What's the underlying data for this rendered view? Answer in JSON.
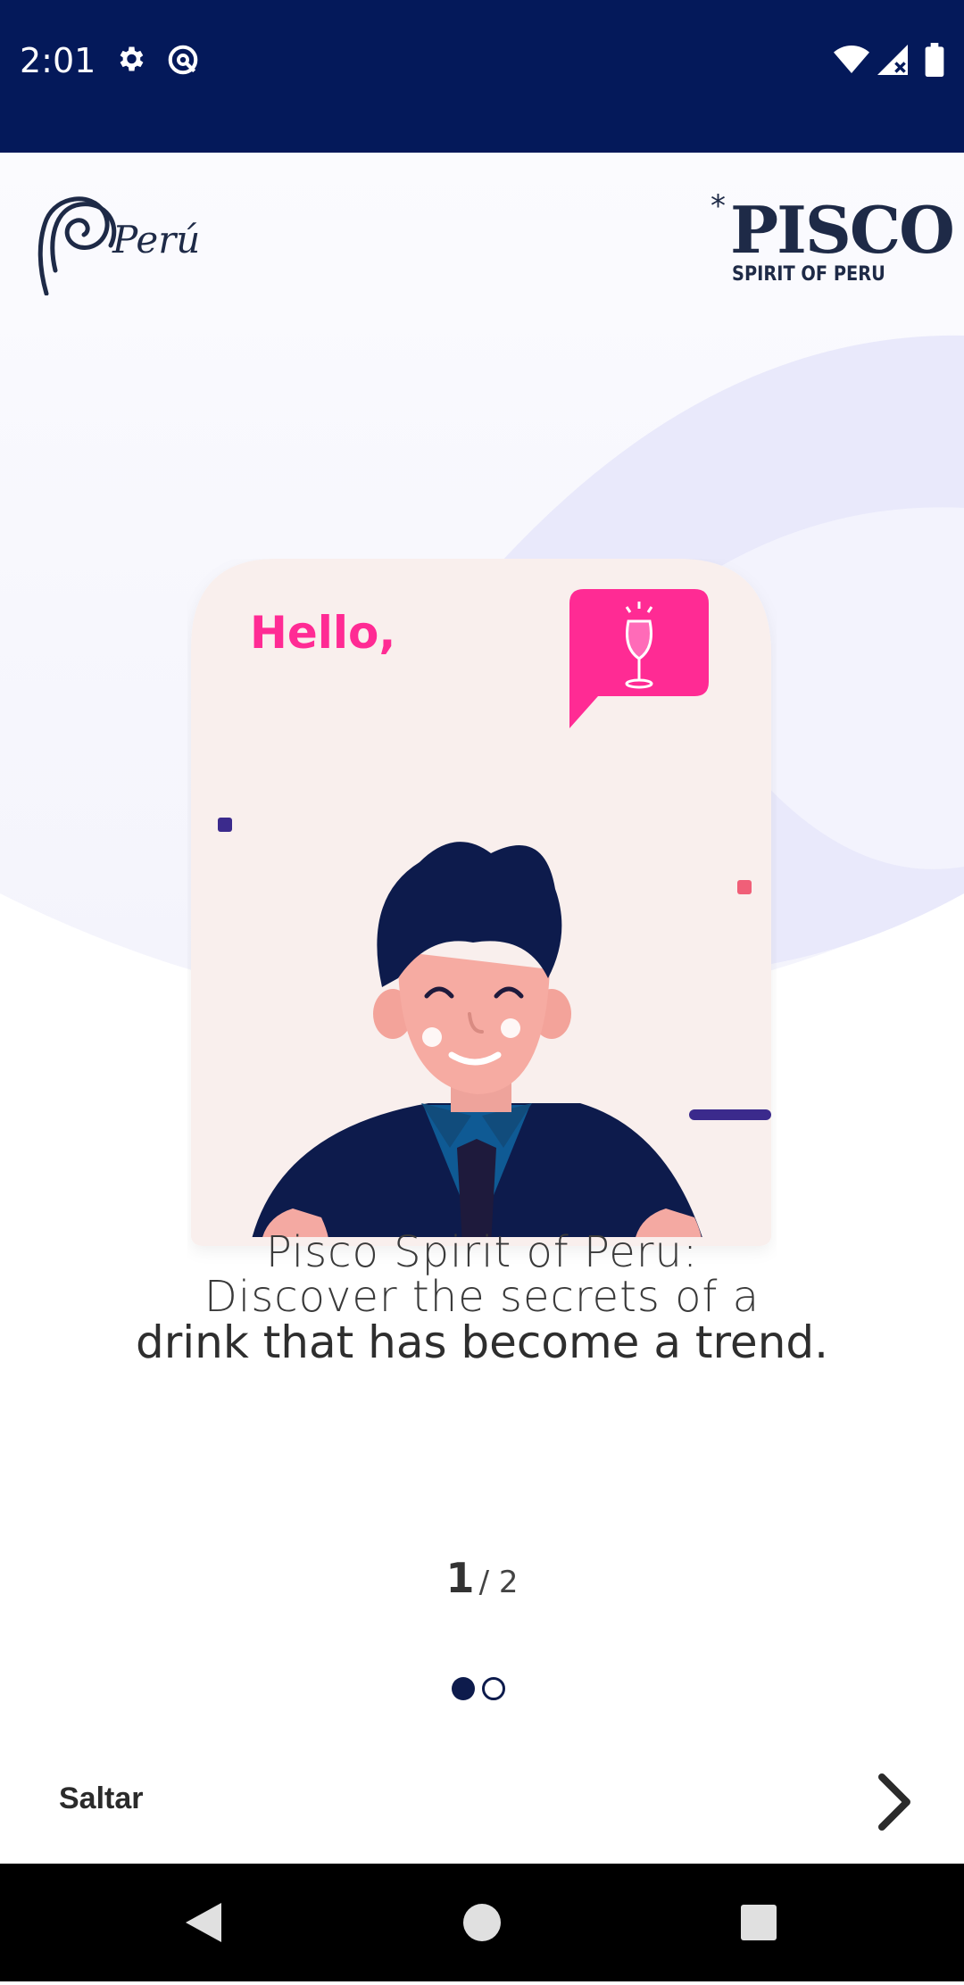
{
  "status_bar": {
    "time": "2:01",
    "icons": [
      "gear-icon",
      "data-saver-icon",
      "wifi-icon",
      "signal-icon",
      "battery-icon"
    ]
  },
  "header": {
    "left_logo": "Perú",
    "right_logo_title": "PISCO",
    "right_logo_star": "*",
    "right_logo_subtitle": "SPIRIT OF PERU"
  },
  "illustration": {
    "greeting": "Hello,",
    "icons": [
      "wine-glass-icon"
    ]
  },
  "headline": {
    "line1": "Pisco Spirit of Peru:",
    "line2": "Discover the secrets of a",
    "line3": "drink that has become a trend."
  },
  "pager": {
    "current": "1",
    "separator": "/ 2",
    "total_pages": 2,
    "active_index": 1
  },
  "footer": {
    "skip_label": "Saltar",
    "next_icon": "chevron-right-icon"
  },
  "nav_bar": {
    "icons": [
      "back-icon",
      "home-icon",
      "recents-icon"
    ]
  },
  "colors": {
    "status_bar": "#04195a",
    "accent_pink": "#ff2b94",
    "navy": "#0d1b4c",
    "card_bg": "#f9efed"
  }
}
